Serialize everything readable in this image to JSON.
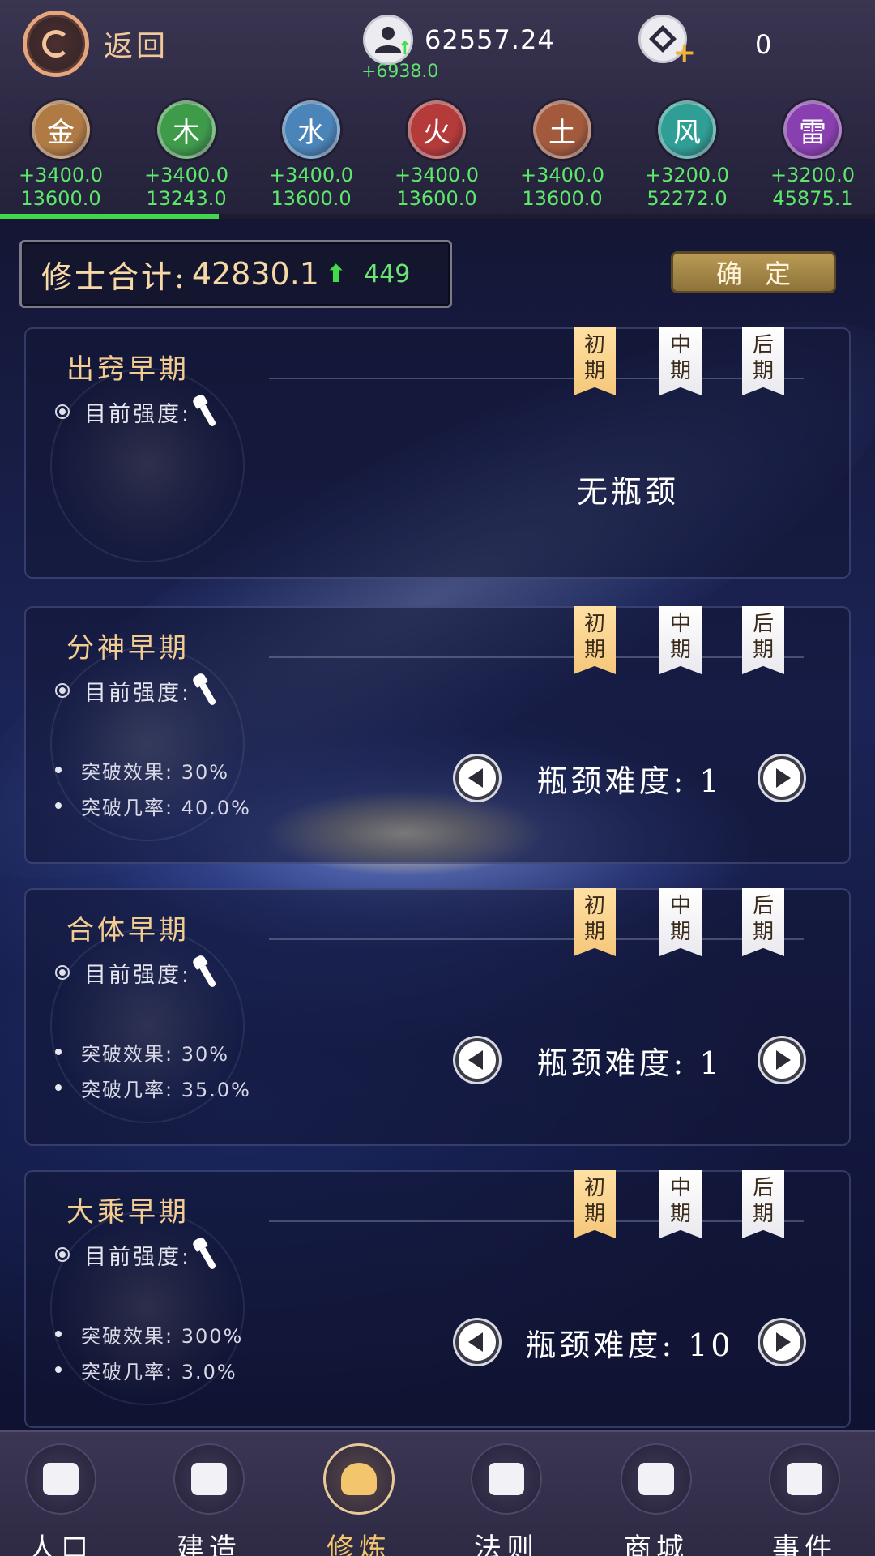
{
  "header": {
    "back_label": "返回",
    "population_value": "62557.24",
    "population_delta": "+6938.0",
    "gems_value": "0"
  },
  "elements": [
    {
      "glyph": "金",
      "rate": "+3400.0",
      "total": "13600.0",
      "color": "#b07a44"
    },
    {
      "glyph": "木",
      "rate": "+3400.0",
      "total": "13243.0",
      "color": "#3e9b4a"
    },
    {
      "glyph": "水",
      "rate": "+3400.0",
      "total": "13600.0",
      "color": "#4a84b8"
    },
    {
      "glyph": "火",
      "rate": "+3400.0",
      "total": "13600.0",
      "color": "#b53a3a"
    },
    {
      "glyph": "土",
      "rate": "+3400.0",
      "total": "13600.0",
      "color": "#a35a3c"
    },
    {
      "glyph": "风",
      "rate": "+3200.0",
      "total": "52272.0",
      "color": "#2f9f96"
    },
    {
      "glyph": "雷",
      "rate": "+3200.0",
      "total": "45875.1",
      "color": "#8a3fb0"
    }
  ],
  "progress_fraction": 0.25,
  "summary": {
    "label": "修士合计:",
    "value": "42830.1",
    "delta": "449",
    "confirm_label": "确定"
  },
  "stages": [
    "初期",
    "中期",
    "后期"
  ],
  "realms": [
    {
      "title": "出窍早期",
      "strength_label": "目前强度:",
      "no_bottleneck": "无瓶颈"
    },
    {
      "title": "分神早期",
      "strength_label": "目前强度:",
      "effect": "突破效果: 30%",
      "chance": "突破几率: 40.0%",
      "difficulty": "瓶颈难度: 1"
    },
    {
      "title": "合体早期",
      "strength_label": "目前强度:",
      "effect": "突破效果: 30%",
      "chance": "突破几率: 35.0%",
      "difficulty": "瓶颈难度: 1"
    },
    {
      "title": "大乘早期",
      "strength_label": "目前强度:",
      "effect": "突破效果: 300%",
      "chance": "突破几率: 3.0%",
      "difficulty": "瓶颈难度: 10"
    }
  ],
  "nav": [
    {
      "label": "人口",
      "icon": "people-icon"
    },
    {
      "label": "建造",
      "icon": "tools-icon"
    },
    {
      "label": "修炼",
      "icon": "meditation-icon"
    },
    {
      "label": "法则",
      "icon": "rules-book-icon"
    },
    {
      "label": "商城",
      "icon": "shop-icon"
    },
    {
      "label": "事件",
      "icon": "event-book-icon"
    }
  ],
  "active_nav_index": 2
}
